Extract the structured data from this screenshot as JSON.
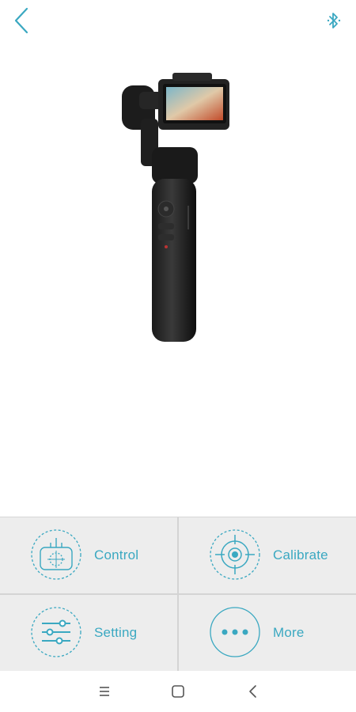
{
  "header": {
    "back_icon": "chevron-left-icon",
    "bluetooth_icon": "bluetooth-icon"
  },
  "colors": {
    "accent": "#3aa8c1",
    "panel_bg": "#ededed",
    "divider": "#d4d4d4"
  },
  "menu": {
    "control": {
      "label": "Control",
      "icon": "joystick-icon"
    },
    "calibrate": {
      "label": "Calibrate",
      "icon": "crosshair-icon"
    },
    "setting": {
      "label": "Setting",
      "icon": "sliders-icon"
    },
    "more": {
      "label": "More",
      "icon": "more-dots-icon"
    }
  },
  "system_nav": {
    "menu_icon": "menu-icon",
    "home_icon": "home-square-icon",
    "back_icon": "back-triangle-icon"
  }
}
